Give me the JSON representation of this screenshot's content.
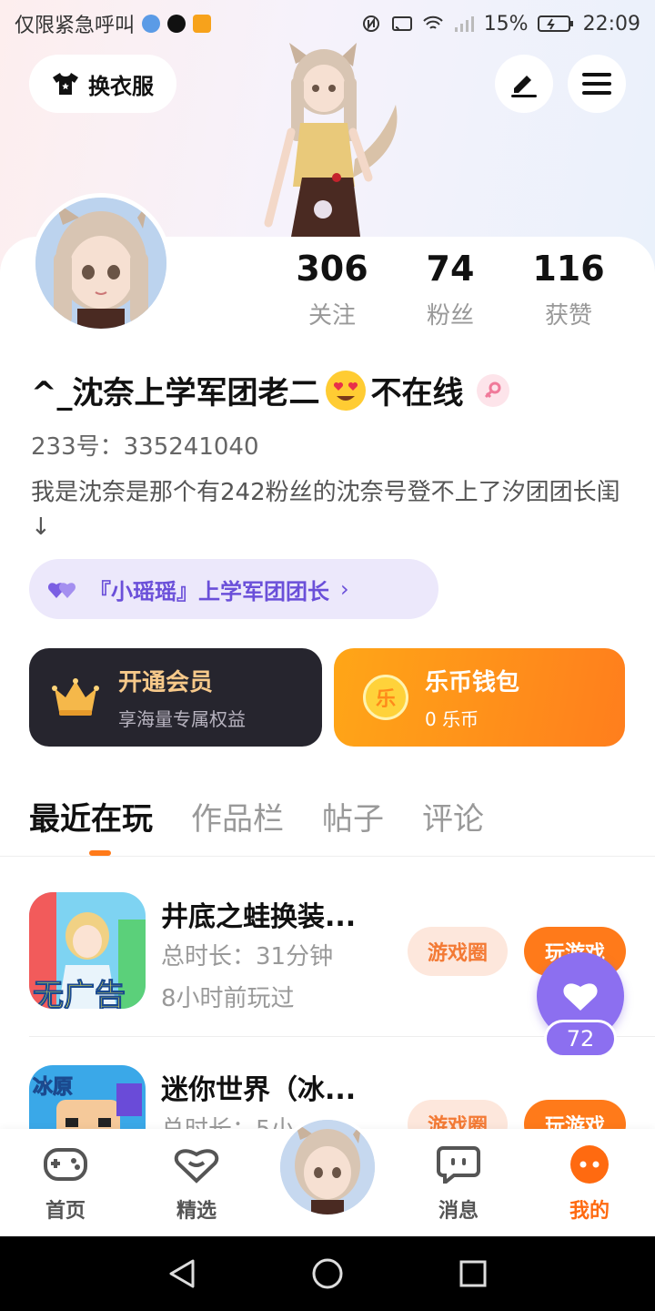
{
  "status_bar": {
    "carrier_text": "仅限紧急呼叫",
    "battery": "15%",
    "time": "22:09"
  },
  "header": {
    "outfit_label": "换衣服"
  },
  "profile": {
    "stats": [
      {
        "value": "306",
        "label": "关注"
      },
      {
        "value": "74",
        "label": "粉丝"
      },
      {
        "value": "116",
        "label": "获赞"
      }
    ],
    "name_prefix": "^_沈奈上学军团老二",
    "name_suffix": "不在线",
    "id_text": "233号：335241040",
    "bio": "我是沈奈是那个有242粉丝的沈奈号登不上了汐团团长闺↓",
    "group": "『小瑶瑶』上学军团团长"
  },
  "cards": {
    "vip_title": "开通会员",
    "vip_sub": "享海量专属权益",
    "wallet_title": "乐币钱包",
    "wallet_sub": "0 乐币",
    "coin_glyph": "乐"
  },
  "tabs": [
    "最近在玩",
    "作品栏",
    "帖子",
    "评论"
  ],
  "games": [
    {
      "title": "井底之蛙换装...",
      "duration": "总时长：31分钟",
      "last_played": "8小时前玩过",
      "icon_text": "无广告",
      "circle_btn": "游戏圈",
      "play_btn": "玩游戏"
    },
    {
      "title": "迷你世界（冰...",
      "duration": "总时长：5小",
      "icon_text": "冰原",
      "circle_btn": "游戏圈",
      "play_btn": "玩游戏"
    }
  ],
  "floating_like": {
    "count": "72"
  },
  "bottom_nav": [
    {
      "label": "首页",
      "icon": "gamepad-icon"
    },
    {
      "label": "精选",
      "icon": "heart-chat-icon"
    },
    {
      "label": "消息",
      "icon": "message-icon"
    },
    {
      "label": "我的",
      "icon": "profile-icon"
    }
  ],
  "colors": {
    "accent": "#ff7a1a",
    "purple": "#8c6ff0",
    "vip_bg": "#26252e"
  }
}
